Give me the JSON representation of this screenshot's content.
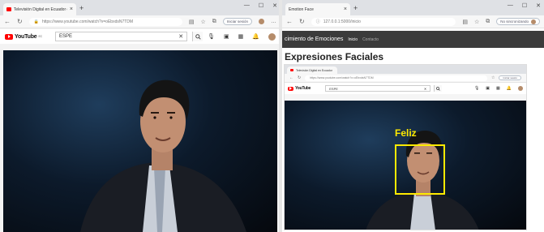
{
  "left_window": {
    "tab_title": "Televisión Digital en Ecuador en ...",
    "url": "https://www.youtube.com/watch?v=oEbxdsN7TDM",
    "signin_label": "Iniciar sesión",
    "youtube": {
      "logo_text": "YouTube",
      "country_suffix": "EC",
      "search_value": "ESPE"
    }
  },
  "right_window": {
    "tab_title": "Emotion Face",
    "url": "127.0.0.1:5000/inicio",
    "sync_label": "No sincronizando",
    "app_nav": {
      "brand": "cimiento de Emociones",
      "links": [
        "Inicio",
        "Contacto"
      ]
    },
    "heading": "Expresiones Faciales",
    "inner_browser": {
      "tab_title": "Televisión Digital en Ecuador en ...",
      "url": "https://www.youtube.com/watch?v=oEbxdsN7TDM",
      "signin_label": "Iniciar sesión",
      "youtube": {
        "logo_text": "YouTube",
        "search_value": "ESPE"
      }
    },
    "detection": {
      "label": "Feliz",
      "box_color": "#ffea00"
    }
  },
  "colors": {
    "youtube_red": "#ff0000",
    "nav_bg": "#3b3b3b",
    "detection": "#ffea00"
  },
  "icons": [
    "back-icon",
    "forward-icon",
    "refresh-icon",
    "mic-icon",
    "create-icon",
    "apps-icon",
    "bell-icon",
    "search-icon",
    "close-icon"
  ]
}
